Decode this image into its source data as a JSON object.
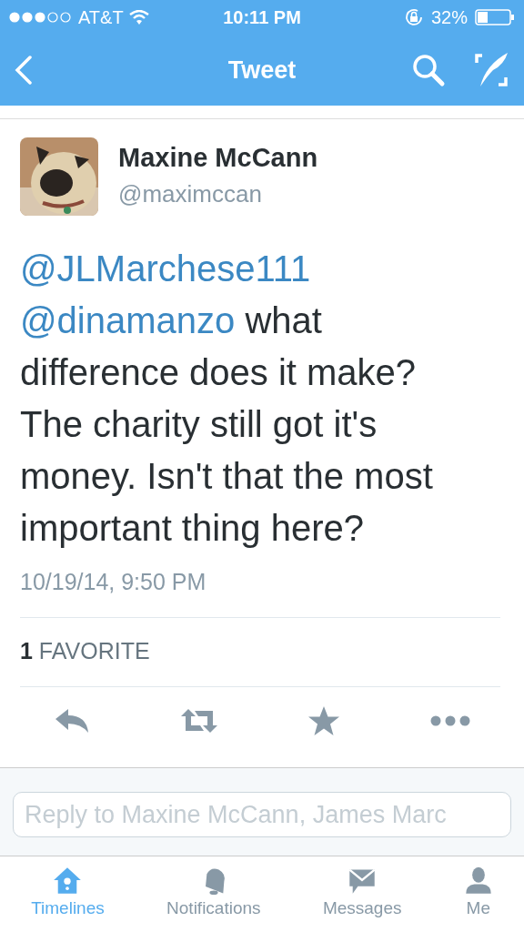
{
  "status_bar": {
    "carrier": "AT&T",
    "time": "10:11 PM",
    "battery": "32%"
  },
  "nav": {
    "title": "Tweet"
  },
  "tweet": {
    "name": "Maxine McCann",
    "handle": "@maximccan",
    "parts": [
      {
        "kind": "mention",
        "text": "@JLMarchese111"
      },
      {
        "kind": "mention",
        "text": "@dinamanzo"
      },
      {
        "kind": "text",
        "text": "what difference does it make? The charity still got it's money. Isn't that the most important thing here?"
      }
    ],
    "timestamp": "10/19/14, 9:50 PM",
    "favorites": "**1** FAVORITE"
  },
  "reply": {
    "placeholder": "Reply to Maxine McCann, James Marc"
  },
  "tabs": [
    {
      "label": "Timelines",
      "selected": true
    },
    {
      "label": "Notifications",
      "selected": false
    },
    {
      "label": "Messages",
      "selected": false
    },
    {
      "label": "Me",
      "selected": false
    }
  ]
}
